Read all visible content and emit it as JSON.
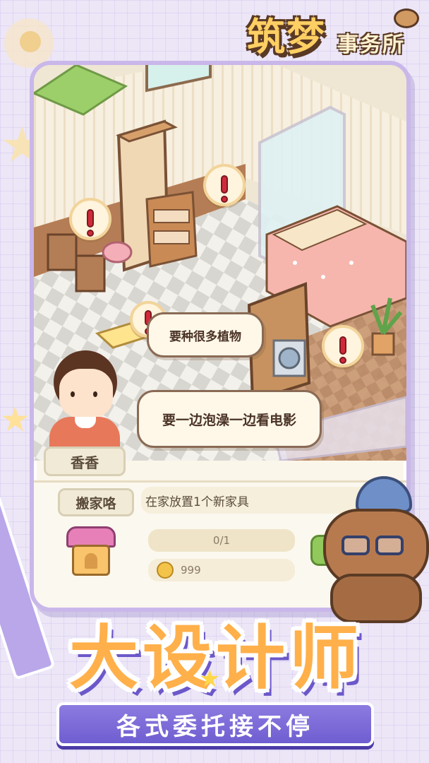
{
  "logo": {
    "line1": "筑梦",
    "line2": "事务所"
  },
  "speech": {
    "plants": "要种很多植物",
    "bath_movie": "要一边泡澡一边看电影"
  },
  "character": {
    "name": "香香"
  },
  "task": {
    "tab_label": "搬家咯",
    "description": "在家放置1个新家具",
    "progress_text": "0/1",
    "progress": 0,
    "reward_amount": "999"
  },
  "promo": {
    "headline": "大设计师",
    "tagline": "各式委托接不停"
  },
  "colors": {
    "accent": "#6f5ed0",
    "headline": "#ffb04a",
    "exclaim": "#d2293a"
  },
  "icons": [
    "paw-icon",
    "exclamation-icon",
    "coin-icon",
    "house-icon",
    "star-icon"
  ]
}
